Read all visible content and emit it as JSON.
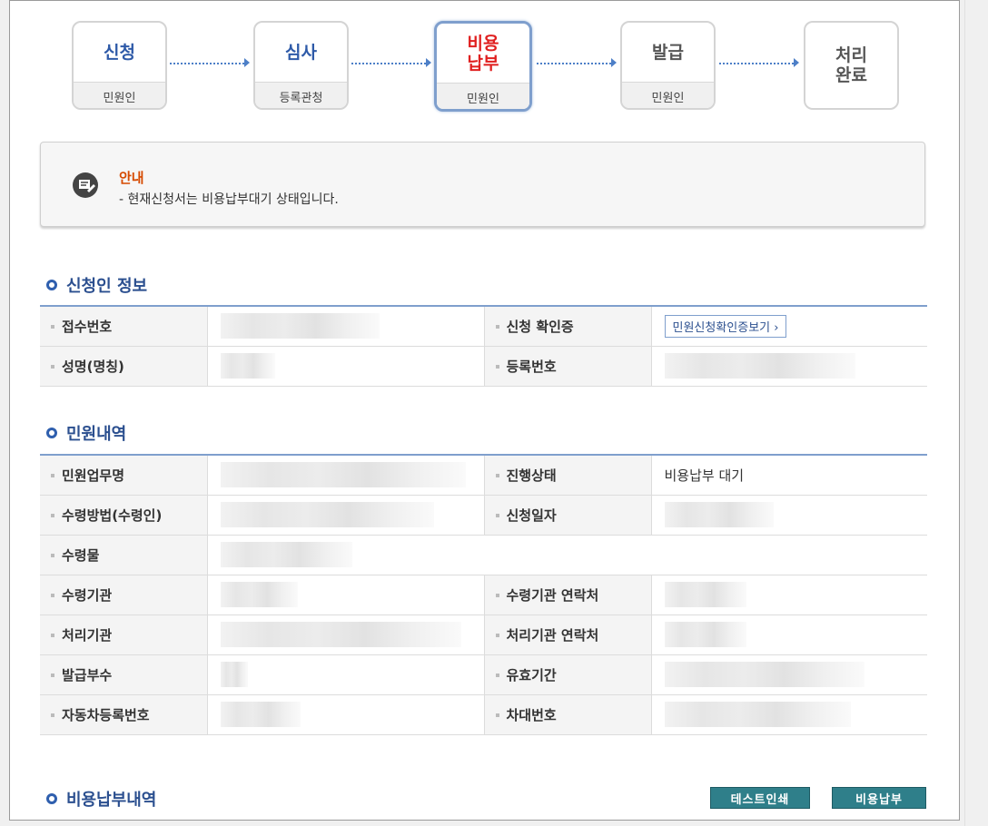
{
  "steps": [
    {
      "title": "신청",
      "who": "민원인",
      "state": "done"
    },
    {
      "title": "심사",
      "who": "등록관청",
      "state": "done"
    },
    {
      "title": "비용\n납부",
      "who": "민원인",
      "state": "active"
    },
    {
      "title": "발급",
      "who": "민원인",
      "state": "pending"
    },
    {
      "title": "처리\n완료",
      "who": "",
      "state": "pending"
    }
  ],
  "notice": {
    "title": "안내",
    "message": "- 현재신청서는 비용납부대기 상태입니다."
  },
  "applicant": {
    "heading": "신청인 정보",
    "receipt_no_label": "접수번호",
    "confirm_label": "신청 확인증",
    "confirm_button": "민원신청확인증보기 ›",
    "name_label": "성명(명칭)",
    "reg_no_label": "등록번호"
  },
  "petition": {
    "heading": "민원내역",
    "task_label": "민원업무명",
    "status_label": "진행상태",
    "status_value": "비용납부 대기",
    "receive_method_label": "수령방법(수령인)",
    "apply_date_label": "신청일자",
    "receive_item_label": "수령물",
    "receive_org_label": "수령기관",
    "receive_org_contact_label": "수령기관 연락처",
    "process_org_label": "처리기관",
    "process_org_contact_label": "처리기관 연락처",
    "copies_label": "발급부수",
    "valid_period_label": "유효기간",
    "car_reg_label": "자동차등록번호",
    "chassis_label": "차대번호"
  },
  "payment": {
    "heading": "비용납부내역",
    "test_print_button": "테스트인쇄",
    "pay_button": "비용납부"
  },
  "colors": {
    "accent": "#2b4f8f",
    "active": "#e02020",
    "button": "#2f7f8a"
  }
}
